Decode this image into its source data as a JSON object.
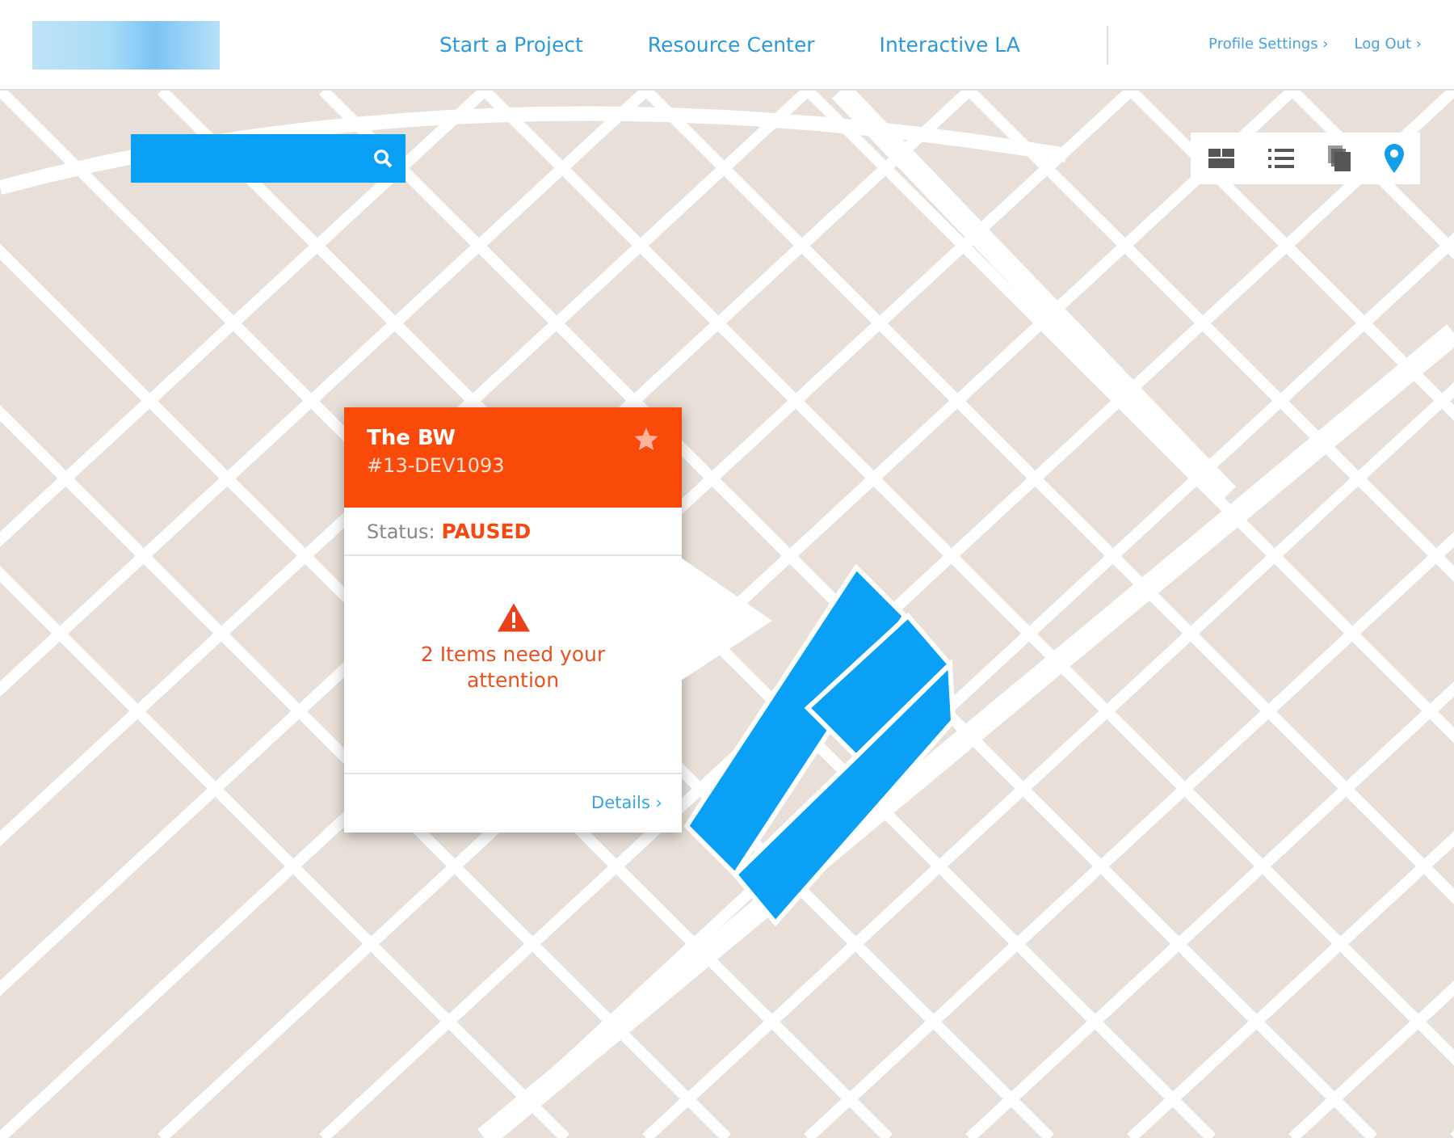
{
  "nav": {
    "links": [
      {
        "label": "Start a Project"
      },
      {
        "label": "Resource Center"
      },
      {
        "label": "Interactive LA"
      }
    ],
    "account_links": [
      {
        "label": "Profile Settings ›"
      },
      {
        "label": "Log Out ›"
      }
    ]
  },
  "view_toggle": [
    {
      "kind": "tiles",
      "selected": false
    },
    {
      "kind": "list",
      "selected": false
    },
    {
      "kind": "stack",
      "selected": false
    },
    {
      "kind": "map",
      "selected": true
    }
  ],
  "popup": {
    "title": "The BW",
    "project_id": "#13-DEV1093",
    "starred": false,
    "status_label": "Status:",
    "status": "PAUSED",
    "alert": "2 Items need your attention",
    "details_link": "Details ›"
  }
}
